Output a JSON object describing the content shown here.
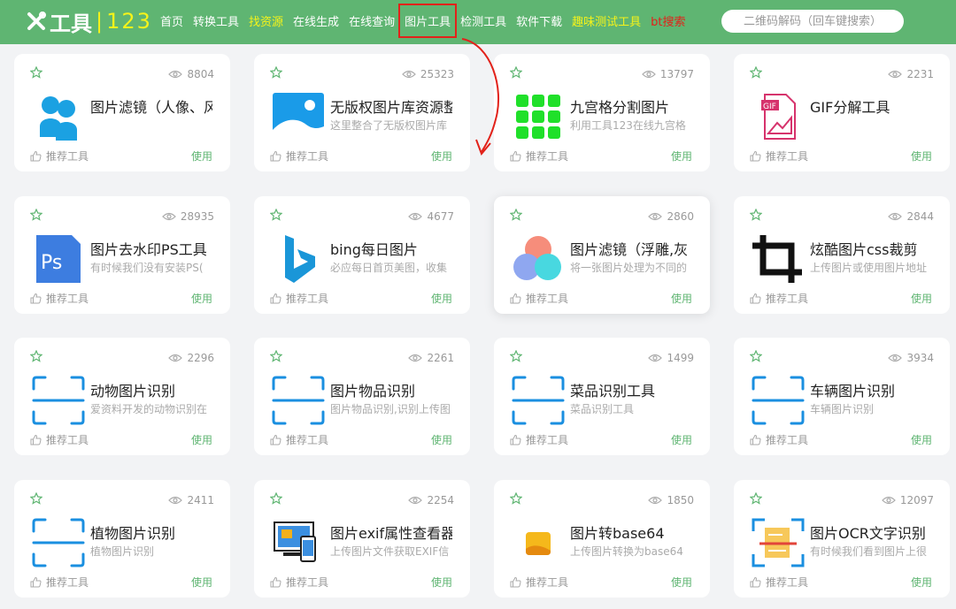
{
  "header": {
    "logo_text": "工具",
    "logo_bar": "|",
    "logo_num": "123",
    "nav": [
      {
        "label": "首页",
        "style": "normal"
      },
      {
        "label": "转换工具",
        "style": "normal"
      },
      {
        "label": "找资源",
        "style": "yellow"
      },
      {
        "label": "在线生成",
        "style": "normal"
      },
      {
        "label": "在线查询",
        "style": "normal"
      },
      {
        "label": "图片工具",
        "style": "highlighted"
      },
      {
        "label": "检测工具",
        "style": "normal"
      },
      {
        "label": "软件下载",
        "style": "normal"
      },
      {
        "label": "趣味测试工具",
        "style": "yellow"
      },
      {
        "label": "bt搜索",
        "style": "red"
      }
    ],
    "search_placeholder": "二维码解码（回车键搜索）"
  },
  "colors": {
    "header_bg": "#5fb572",
    "accent_green": "#5fb572",
    "highlight_yellow": "#f5f31a",
    "highlight_red": "#e2221a"
  },
  "cards": [
    {
      "title": "图片滤镜（人像、风",
      "desc": "",
      "views": "8804",
      "icon": "silhouette-icon",
      "rec": "推荐工具",
      "use": "使用"
    },
    {
      "title": "无版权图片库资源整",
      "desc": "这里整合了无版权图片库",
      "views": "25323",
      "icon": "image-icon",
      "rec": "推荐工具",
      "use": "使用"
    },
    {
      "title": "九宫格分割图片",
      "desc": "利用工具123在线九宫格",
      "views": "13797",
      "icon": "grid-icon",
      "rec": "推荐工具",
      "use": "使用"
    },
    {
      "title": "GIF分解工具",
      "desc": "",
      "views": "2231",
      "icon": "gif-icon",
      "rec": "推荐工具",
      "use": "使用"
    },
    {
      "title": "图片去水印PS工具",
      "desc": "有时候我们没有安装PS(",
      "views": "28935",
      "icon": "ps-icon",
      "rec": "推荐工具",
      "use": "使用"
    },
    {
      "title": "bing每日图片",
      "desc": "必应每日首页美图，收集",
      "views": "4677",
      "icon": "bing-icon",
      "rec": "推荐工具",
      "use": "使用"
    },
    {
      "title": "图片滤镜（浮雕,灰",
      "desc": "将一张图片处理为不同的",
      "views": "2860",
      "icon": "color-circles-icon",
      "rec": "推荐工具",
      "use": "使用"
    },
    {
      "title": "炫酷图片css裁剪",
      "desc": "上传图片或使用图片地址",
      "views": "2844",
      "icon": "crop-icon",
      "rec": "推荐工具",
      "use": "使用"
    },
    {
      "title": "动物图片识别",
      "desc": "爱资料开发的动物识别在",
      "views": "2296",
      "icon": "scan-icon",
      "rec": "推荐工具",
      "use": "使用"
    },
    {
      "title": "图片物品识别",
      "desc": "图片物品识别,识别上传图",
      "views": "2261",
      "icon": "scan-icon",
      "rec": "推荐工具",
      "use": "使用"
    },
    {
      "title": "菜品识别工具",
      "desc": "菜品识别工具",
      "views": "1499",
      "icon": "scan-icon",
      "rec": "推荐工具",
      "use": "使用"
    },
    {
      "title": "车辆图片识别",
      "desc": "车辆图片识别",
      "views": "3934",
      "icon": "scan-icon",
      "rec": "推荐工具",
      "use": "使用"
    },
    {
      "title": "植物图片识别",
      "desc": "植物图片识别",
      "views": "2411",
      "icon": "scan-icon",
      "rec": "推荐工具",
      "use": "使用"
    },
    {
      "title": "图片exif属性查看器",
      "desc": "上传图片文件获取EXIF信",
      "views": "2254",
      "icon": "devices-icon",
      "rec": "推荐工具",
      "use": "使用"
    },
    {
      "title": "图片转base64",
      "desc": "上传图片转换为base64",
      "views": "1850",
      "icon": "photo-small-icon",
      "rec": "推荐工具",
      "use": "使用"
    },
    {
      "title": "图片OCR文字识别",
      "desc": "有时候我们看到图片上很",
      "views": "12097",
      "icon": "ocr-icon",
      "rec": "推荐工具",
      "use": "使用"
    }
  ]
}
